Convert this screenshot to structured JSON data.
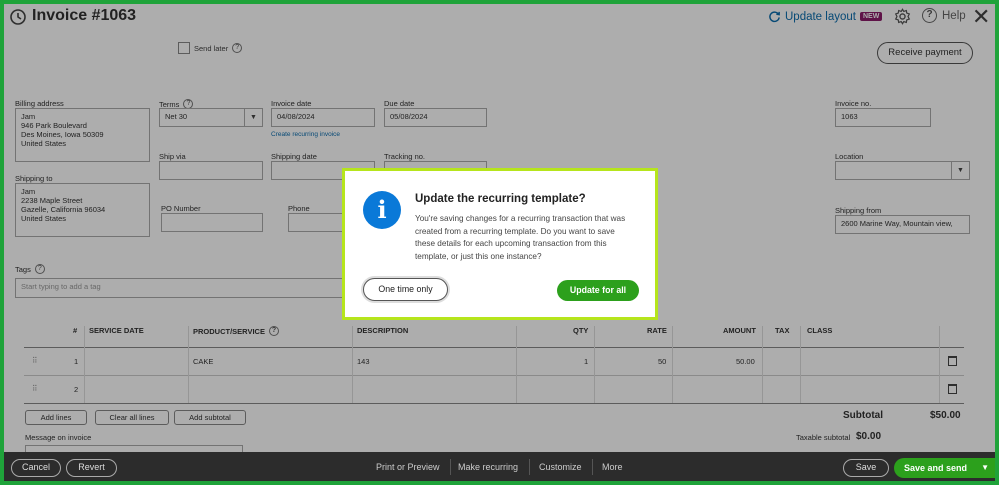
{
  "header": {
    "title": "Invoice #1063",
    "update_layout": "Update layout",
    "new_badge": "NEW",
    "help": "Help"
  },
  "top": {
    "send_later": "Send later",
    "receive_payment": "Receive payment"
  },
  "form": {
    "billing_address_label": "Billing address",
    "billing_address": [
      "Jam",
      "946 Park Boulevard",
      "Des Moines, Iowa  50309",
      "United States"
    ],
    "terms_label": "Terms",
    "terms_value": "Net 30",
    "invoice_date_label": "Invoice date",
    "invoice_date": "04/08/2024",
    "create_recurring": "Create recurring invoice",
    "due_date_label": "Due date",
    "due_date": "05/08/2024",
    "invoice_no_label": "Invoice no.",
    "invoice_no": "1063",
    "ship_via_label": "Ship via",
    "shipping_date_label": "Shipping date",
    "tracking_no_label": "Tracking no.",
    "location_label": "Location",
    "shipping_to_label": "Shipping to",
    "shipping_to": [
      "Jam",
      "2238 Maple Street",
      "Gazelle, California  96034",
      "United States"
    ],
    "po_number_label": "PO Number",
    "phone_label": "Phone",
    "shipping_from_label": "Shipping from",
    "shipping_from": "2600 Marine Way, Mountain view,",
    "tags_label": "Tags",
    "tags_placeholder": "Start typing to add a tag"
  },
  "table": {
    "headers": {
      "num": "#",
      "service_date": "SERVICE DATE",
      "product": "PRODUCT/SERVICE",
      "description": "DESCRIPTION",
      "qty": "QTY",
      "rate": "RATE",
      "amount": "AMOUNT",
      "tax": "TAX",
      "class": "CLASS"
    },
    "rows": [
      {
        "num": "1",
        "product": "CAKE",
        "description": "143",
        "qty": "1",
        "rate": "50",
        "amount": "50.00"
      },
      {
        "num": "2",
        "product": "",
        "description": "",
        "qty": "",
        "rate": "",
        "amount": ""
      }
    ],
    "add_lines": "Add lines",
    "clear_all_lines": "Clear all lines",
    "add_subtotal": "Add subtotal",
    "message_label": "Message on invoice",
    "subtotal_label": "Subtotal",
    "subtotal_value": "$50.00",
    "taxable_label": "Taxable subtotal",
    "taxable_value": "$0.00"
  },
  "footer": {
    "cancel": "Cancel",
    "revert": "Revert",
    "print_preview": "Print or Preview",
    "make_recurring": "Make recurring",
    "customize": "Customize",
    "more": "More",
    "save": "Save",
    "save_and_send": "Save and send"
  },
  "modal": {
    "title": "Update the recurring template?",
    "body": "You're saving changes for a recurring transaction that was created from a recurring template. Do you want to save these details for each upcoming transaction from this template, or just this one instance?",
    "one_time": "One time only",
    "update_all": "Update for all"
  },
  "colors": {
    "frame_green": "#1fa33a",
    "accent_green": "#2ca01c",
    "link_blue": "#0b6dae",
    "info_blue": "#0a79d8",
    "modal_highlight": "#b6e51c"
  }
}
